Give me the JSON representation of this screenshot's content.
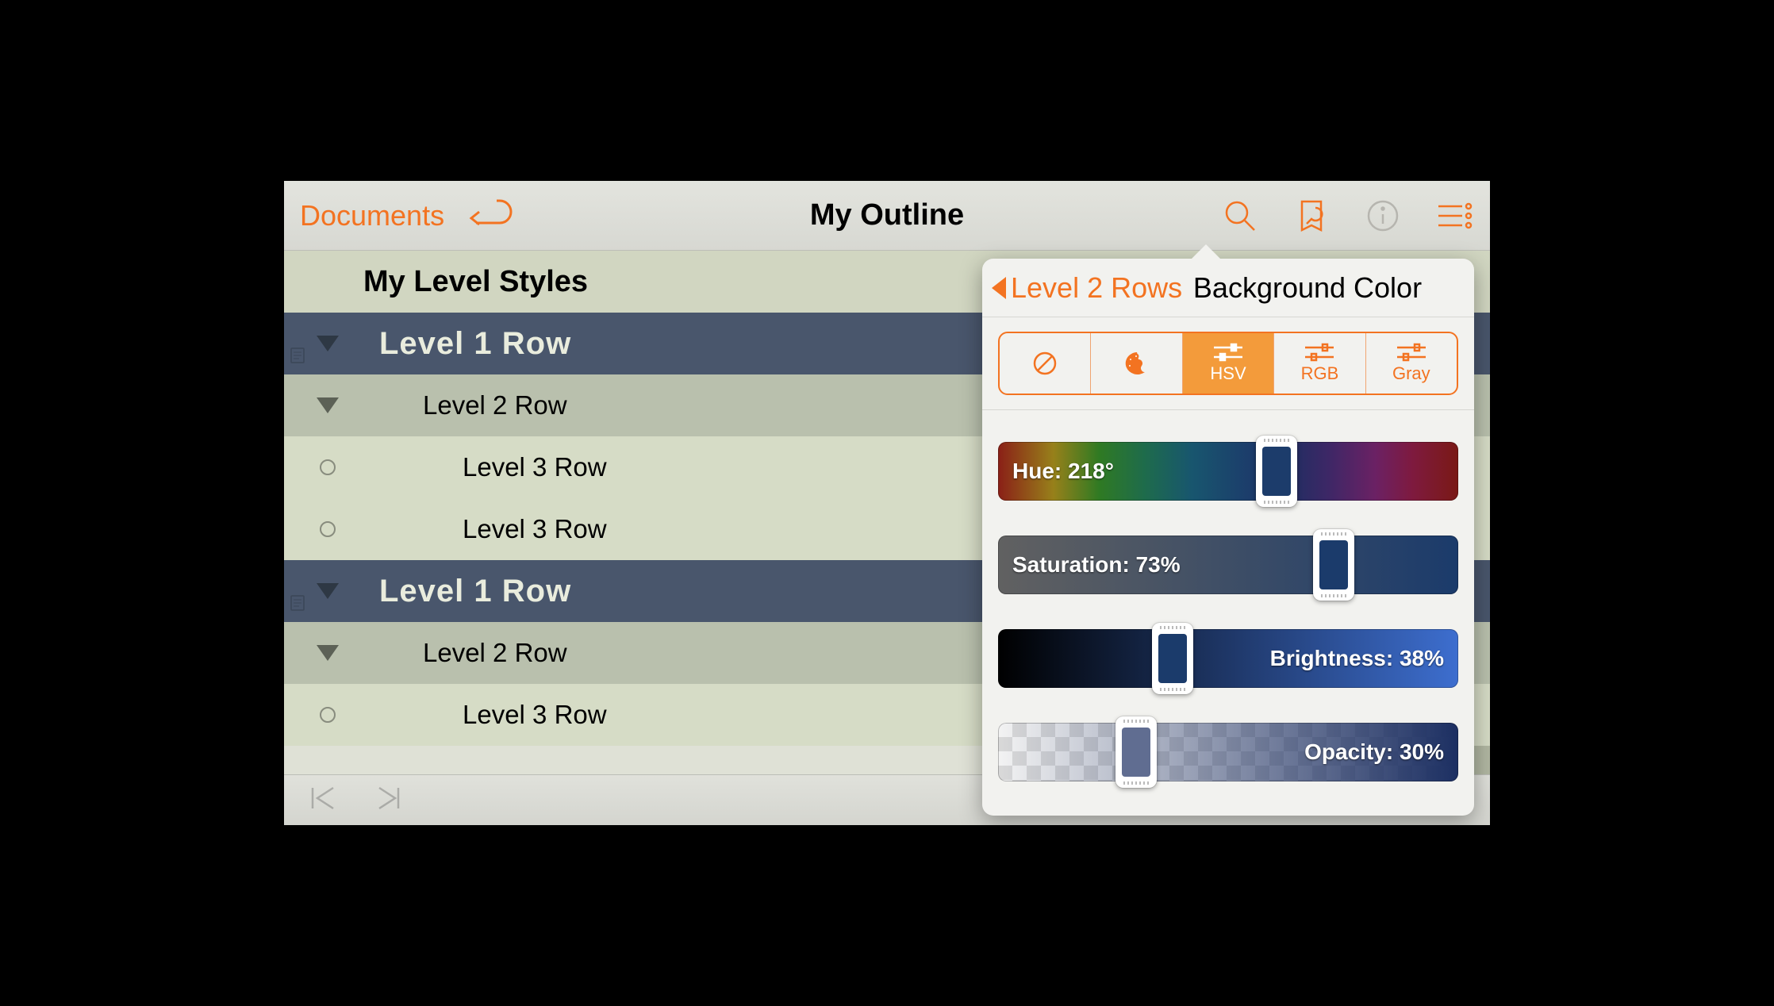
{
  "toolbar": {
    "documents_label": "Documents",
    "title": "My Outline"
  },
  "outline": {
    "header": "My Level Styles",
    "rows": [
      {
        "level": 1,
        "text": "Level 1 Row",
        "has_note": true
      },
      {
        "level": 2,
        "text": "Level 2 Row"
      },
      {
        "level": 3,
        "text": "Level 3 Row"
      },
      {
        "level": 3,
        "text": "Level 3 Row"
      },
      {
        "level": 1,
        "text": "Level 1 Row",
        "has_note": true
      },
      {
        "level": 2,
        "text": "Level 2 Row"
      },
      {
        "level": 3,
        "text": "Level 3 Row"
      }
    ]
  },
  "popover": {
    "back_label": "Level 2 Rows",
    "title": "Background Color",
    "tabs": {
      "none": "",
      "palette": "",
      "hsv": "HSV",
      "rgb": "RGB",
      "gray": "Gray",
      "active": "hsv"
    },
    "sliders": {
      "hue": {
        "label_prefix": "Hue: ",
        "value": 218,
        "unit": "°",
        "percent": 60.5,
        "swatch": "#1c3c6b"
      },
      "saturation": {
        "label_prefix": "Saturation: ",
        "value": 73,
        "unit": "%",
        "percent": 73,
        "swatch": "#1b3b6b"
      },
      "brightness": {
        "label_prefix": "Brightness: ",
        "value": 38,
        "unit": "%",
        "percent": 38,
        "swatch": "#1b3b6b"
      },
      "opacity": {
        "label_prefix": "Opacity: ",
        "value": 30,
        "unit": "%",
        "percent": 30,
        "swatch": "rgba(28,47,98,.7)"
      }
    }
  }
}
